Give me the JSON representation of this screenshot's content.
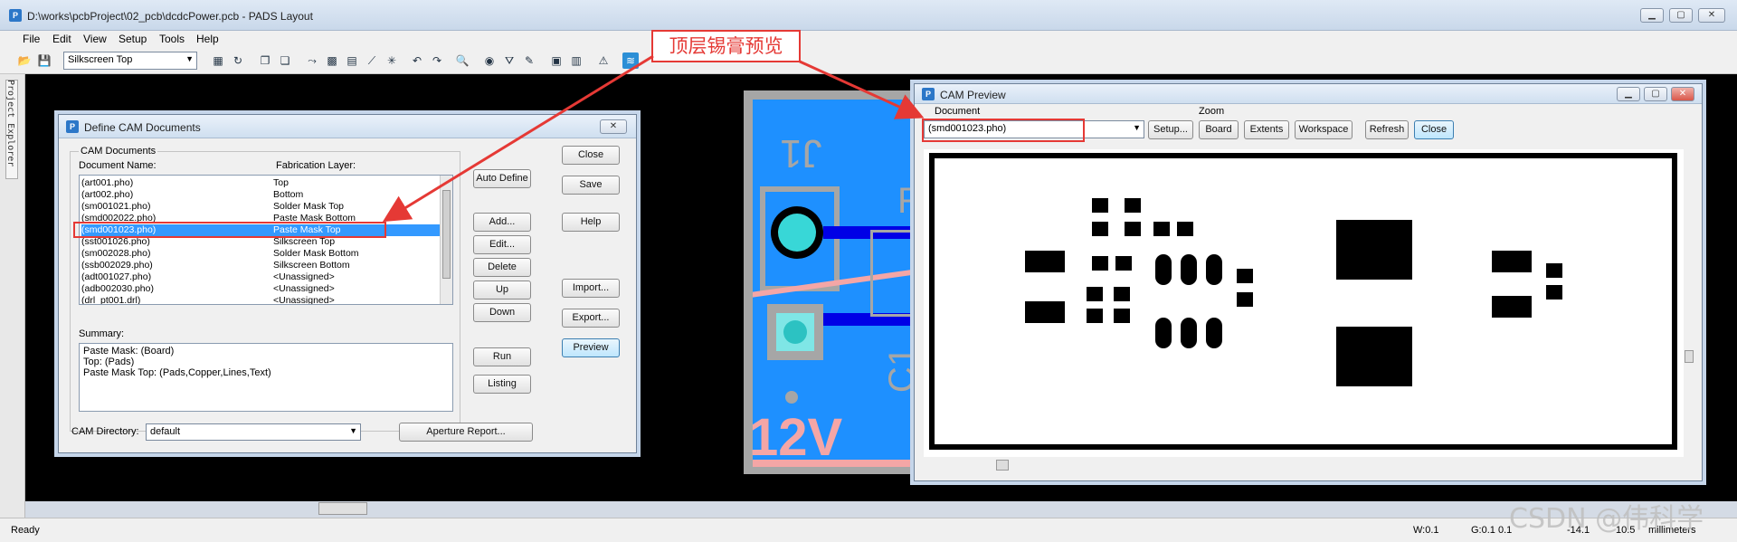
{
  "app": {
    "title": "D:\\works\\pcbProject\\02_pcb\\dcdcPower.pcb - PADS Layout"
  },
  "menu": [
    "File",
    "Edit",
    "View",
    "Setup",
    "Tools",
    "Help"
  ],
  "toolbar": {
    "layer_select": "Silkscreen Top"
  },
  "left_panel": {
    "label": "Project Explorer"
  },
  "callout": {
    "text": "顶层锡膏预览"
  },
  "define_cam": {
    "title": "Define CAM Documents",
    "group_label": "CAM Documents",
    "col_doc": "Document Name:",
    "col_layer": "Fabrication Layer:",
    "rows": [
      {
        "doc": "(art001.pho)",
        "layer": "Top"
      },
      {
        "doc": "(art002.pho)",
        "layer": "Bottom"
      },
      {
        "doc": "(sm001021.pho)",
        "layer": "Solder Mask Top"
      },
      {
        "doc": "(smd002022.pho)",
        "layer": "Paste Mask Bottom"
      },
      {
        "doc": "(smd001023.pho)",
        "layer": "Paste Mask Top"
      },
      {
        "doc": "(sst001026.pho)",
        "layer": "Silkscreen Top"
      },
      {
        "doc": "(sm002028.pho)",
        "layer": "Solder Mask Bottom"
      },
      {
        "doc": "(ssb002029.pho)",
        "layer": "Silkscreen Bottom"
      },
      {
        "doc": "(adt001027.pho)",
        "layer": "<Unassigned>"
      },
      {
        "doc": "(adb002030.pho)",
        "layer": "<Unassigned>"
      },
      {
        "doc": "(drl_pt001.drl)",
        "layer": "<Unassigned>"
      }
    ],
    "selected_index": 4,
    "buttons_mid": [
      "Auto Define",
      "Add...",
      "Edit...",
      "Delete",
      "Up",
      "Down",
      "Run",
      "Listing"
    ],
    "buttons_right": [
      "Close",
      "Save",
      "Help",
      "Import...",
      "Export...",
      "Preview"
    ],
    "summary_label": "Summary:",
    "summary_lines": [
      "Paste Mask: (Board)",
      "Top: (Pads)",
      "Paste Mask Top: (Pads,Copper,Lines,Text)"
    ],
    "camdir_label": "CAM Directory:",
    "camdir_value": "default",
    "aperture_button": "Aperture Report..."
  },
  "pcb": {
    "labels": [
      "J1",
      "R",
      "C1",
      "12V"
    ]
  },
  "cam_preview": {
    "title": "CAM Preview",
    "document_label": "Document",
    "document_value": "(smd001023.pho)",
    "setup_button": "Setup...",
    "zoom_label": "Zoom",
    "zoom_buttons": [
      "Board",
      "Extents",
      "Workspace"
    ],
    "refresh_button": "Refresh",
    "close_button": "Close"
  },
  "status": {
    "ready": "Ready",
    "width": "W:0.1",
    "grid": "G:0.1 0.1",
    "x": "-14.1",
    "y": "10.5",
    "units": "millimeters"
  },
  "watermark": "CSDN @伟科学"
}
